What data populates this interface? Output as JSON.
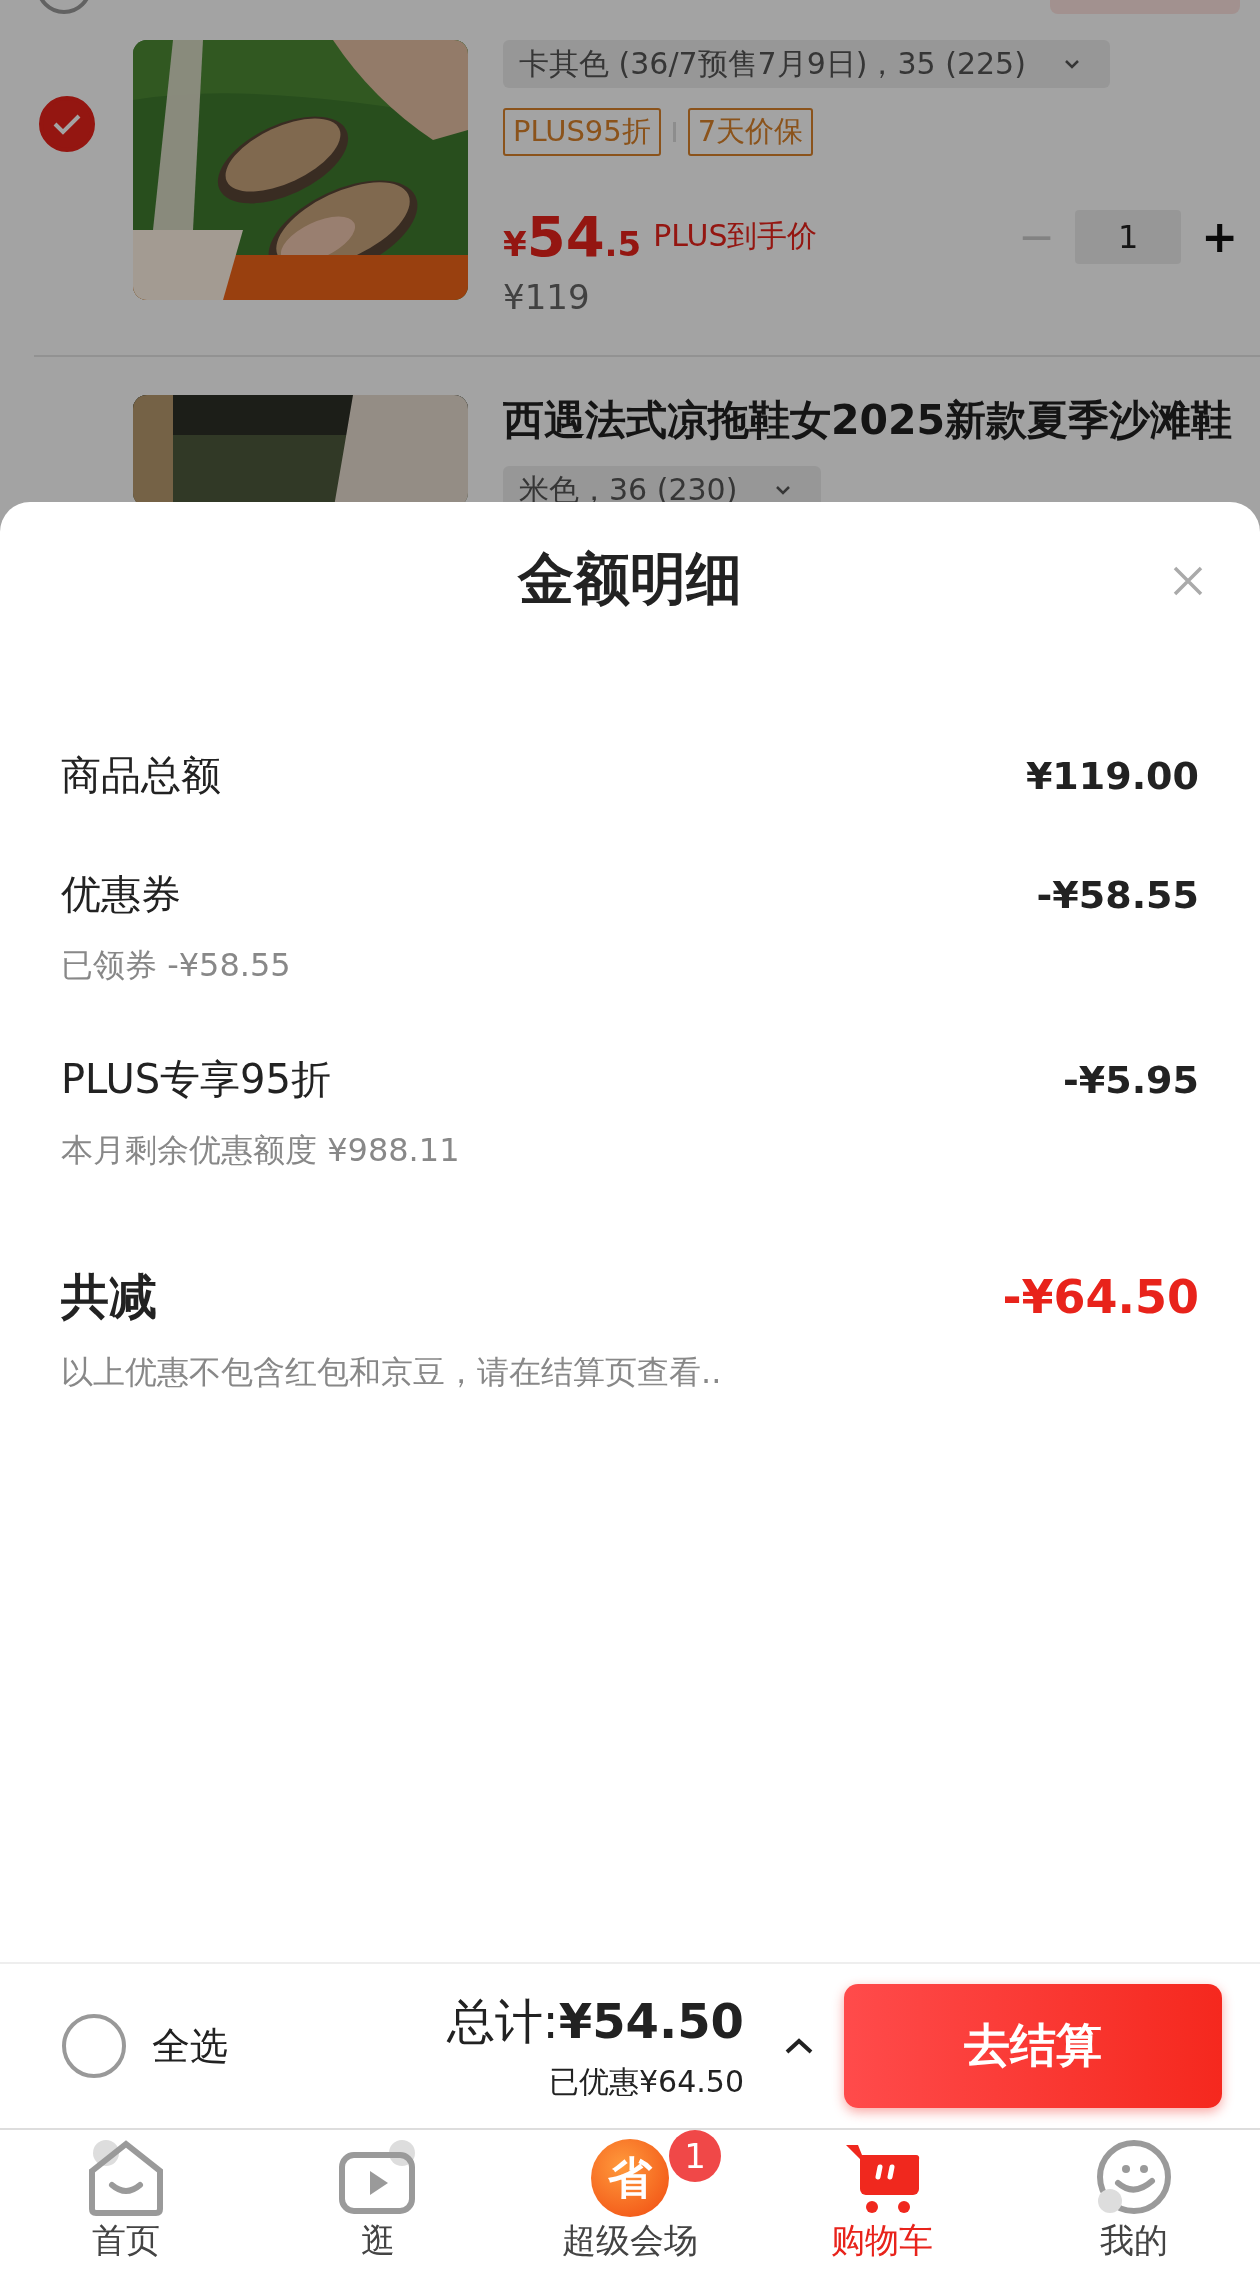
{
  "cart": {
    "store_row": {
      "checked": false
    },
    "item": {
      "checked": true,
      "variant": "卡其色 (36/7预售7月9日)，35 (225)",
      "tags": [
        "PLUS95折",
        "7天价保"
      ],
      "price": {
        "currency": "¥",
        "integer": "54",
        "decimal": ".5"
      },
      "price_label": "PLUS到手价",
      "original_price": "¥119",
      "quantity": "1",
      "minus": "−",
      "plus": "+"
    },
    "next_item": {
      "title": "西遇法式凉拖鞋女2025新款夏季沙滩鞋",
      "variant": "米色，36 (230)"
    }
  },
  "sheet": {
    "title": "金额明细",
    "rows": [
      {
        "kind": "line",
        "label": "商品总额",
        "value": "¥119.00"
      },
      {
        "kind": "line",
        "label": "优惠券",
        "value": "-¥58.55",
        "note": "已领券 -¥58.55"
      },
      {
        "kind": "line",
        "label": "PLUS专享95折",
        "value": "-¥5.95",
        "note": "本月剩余优惠额度 ¥988.11"
      },
      {
        "kind": "total",
        "label": "共减",
        "value": "-¥64.50",
        "note": "以上优惠不包含红包和京豆，请在结算页查看.."
      }
    ]
  },
  "bottom_bar": {
    "select_all": {
      "label": "全选",
      "checked": false
    },
    "total": "总计:**¥54.50**",
    "saved": "已优惠¥64.50",
    "checkout": "去结算"
  },
  "tabs": [
    {
      "kind": "home",
      "label": "首页",
      "selected": false
    },
    {
      "kind": "video",
      "label": "逛",
      "selected": false
    },
    {
      "kind": "promo",
      "label": "超级会场",
      "icon_text": "省",
      "badge": "1",
      "selected": false
    },
    {
      "kind": "cart",
      "label": "购物车",
      "selected": true
    },
    {
      "kind": "profile",
      "label": "我的",
      "selected": false
    }
  ]
}
